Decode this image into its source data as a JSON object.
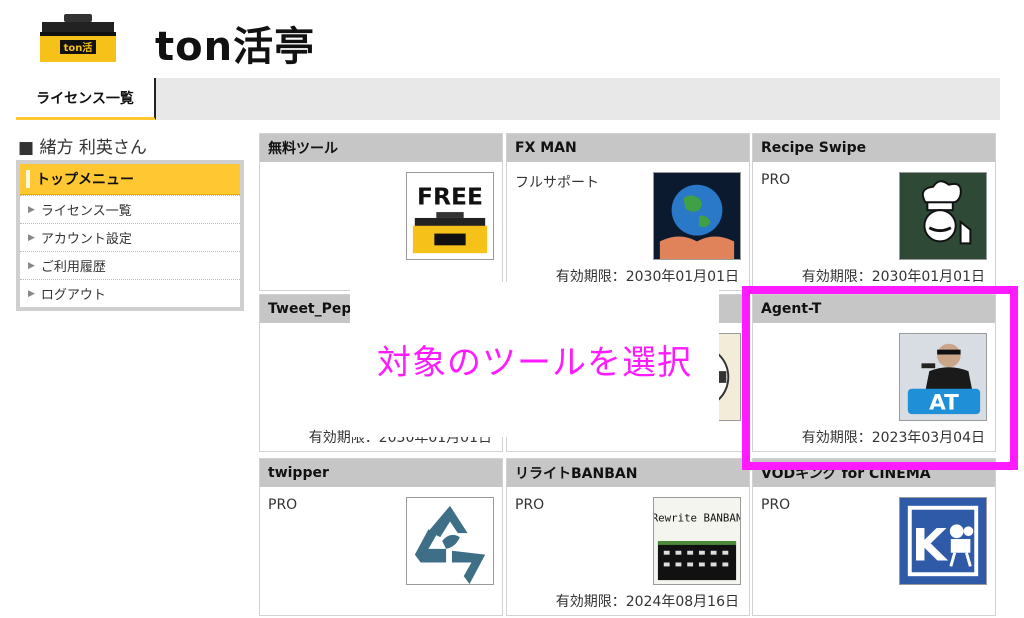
{
  "header": {
    "logo_text": "ton活",
    "site_title": "ton活亭"
  },
  "tabs": [
    {
      "label": "ライセンス一覧",
      "active": true
    }
  ],
  "sidebar": {
    "user": "■ 緒方 利英さん",
    "menu_title": "トップメニュー",
    "items": [
      {
        "label": "ライセンス一覧"
      },
      {
        "label": "アカウント設定"
      },
      {
        "label": "ご利用履歴"
      },
      {
        "label": "ログアウト"
      }
    ]
  },
  "tools": [
    {
      "name": "無料ツール",
      "plan": "",
      "expiry": "",
      "icon": "free-toolbox-icon",
      "icon_text": "FREE"
    },
    {
      "name": "FX MAN",
      "plan": "フルサポート",
      "expiry": "有効期限：2030年01月01日",
      "icon": "earth-hands-icon"
    },
    {
      "name": "Recipe Swipe",
      "plan": "PRO",
      "expiry": "有効期限：2030年01月01日",
      "icon": "chef-icon"
    },
    {
      "name": "Tweet_Pep",
      "plan": "",
      "expiry": "有効期限：2030年01月01日",
      "icon": ""
    },
    {
      "name": "",
      "plan": "",
      "expiry": "",
      "icon": "badge-icon"
    },
    {
      "name": "Agent-T",
      "plan": "",
      "expiry": "有効期限：2023年03月04日",
      "icon": "agent-icon",
      "icon_text": "AT"
    },
    {
      "name": "twipper",
      "plan": "PRO",
      "expiry": "",
      "icon": "recycle-bird-icon"
    },
    {
      "name": "リライトBANBAN",
      "plan": "PRO",
      "expiry": "有効期限：2024年08月16日",
      "icon": "rewrite-banban-icon",
      "icon_text": "Rewrite BANBAN"
    },
    {
      "name": "VODキング for CINEMA",
      "plan": "PRO",
      "expiry": "",
      "icon": "k-camera-icon",
      "icon_text": "K"
    }
  ],
  "overlay": {
    "callout_text": "対象のツールを選択",
    "highlight_target": "Agent-T"
  },
  "colors": {
    "accent": "#ffc832",
    "card_header": "#c6c6c6",
    "highlight": "#ff1aff"
  }
}
